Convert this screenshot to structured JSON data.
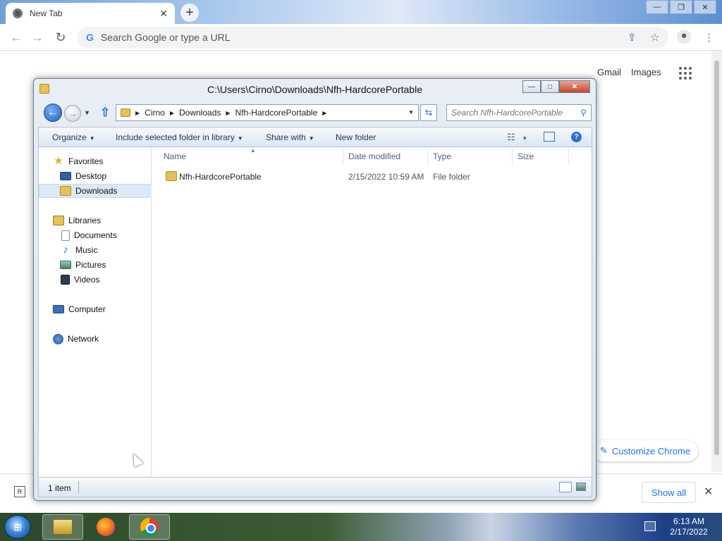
{
  "browser": {
    "tab_title": "New Tab",
    "tab_close": "✕",
    "new_tab": "+",
    "omnibox_placeholder": "Search Google or type a URL",
    "omnibox_g": "G",
    "nav": {
      "back": "←",
      "forward": "→",
      "reload": "↻"
    },
    "gmail": "Gmail",
    "images": "Images",
    "customize_chrome": "Customize Chrome",
    "customize_icon": "✎",
    "show_all": "Show all",
    "download_close": "✕",
    "download_icon": "R",
    "window_controls": {
      "minimize": "—",
      "maximize": "❐",
      "close": "✕"
    }
  },
  "explorer": {
    "title": "C:\\Users\\Cirno\\Downloads\\Nfh-HardcorePortable",
    "window_controls": {
      "minimize": "—",
      "maximize": "□",
      "close": "✕"
    },
    "back": "←",
    "forward": "→",
    "up": "⇧",
    "recent_dropdown": "▼",
    "address": {
      "crumbs": [
        "Cirno",
        "Downloads",
        "Nfh-HardcorePortable"
      ],
      "separator": "▶",
      "dropdown": "▼"
    },
    "refresh": "⇆",
    "search_placeholder": "Search Nfh-HardcorePortable",
    "search_icon": "⚲",
    "commands": {
      "organize": "Organize",
      "include": "Include selected folder in library",
      "share": "Share with",
      "new_folder": "New folder",
      "dropdown": "▼",
      "views": "☷",
      "help": "?"
    },
    "nav_pane": {
      "favorites": "Favorites",
      "desktop": "Desktop",
      "downloads": "Downloads",
      "libraries": "Libraries",
      "documents": "Documents",
      "music": "Music",
      "pictures": "Pictures",
      "videos": "Videos",
      "computer": "Computer",
      "network": "Network",
      "star": "★",
      "note": "♪"
    },
    "columns": {
      "name": "Name",
      "date": "Date modified",
      "type": "Type",
      "size": "Size",
      "sort": "▲"
    },
    "files": [
      {
        "name": "Nfh-HardcorePortable",
        "date": "2/15/2022 10:59 AM",
        "type": "File folder",
        "size": ""
      }
    ],
    "status": "1 item"
  },
  "taskbar": {
    "start": "⊞",
    "time": "6:13 AM",
    "date": "2/17/2022"
  },
  "icons": {
    "chrome_tab": "chrome-icon",
    "explorer": "folder-icon",
    "firefox": "firefox-icon",
    "chrome": "chrome-icon"
  }
}
